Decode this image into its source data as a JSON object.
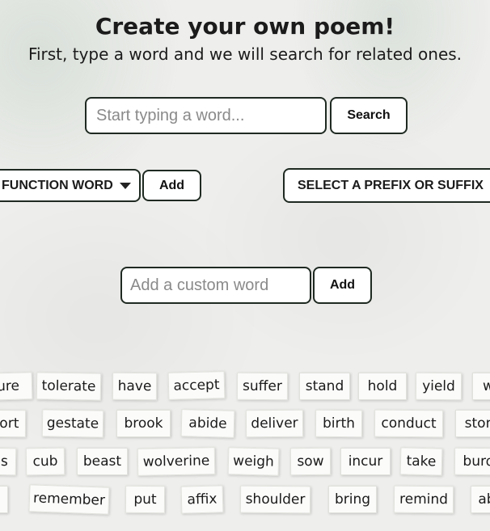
{
  "header": {
    "title": "Create your own poem!",
    "subtitle": "First, type a word and we will search for related ones."
  },
  "search": {
    "placeholder": "Start typing a word...",
    "button_label": "Search"
  },
  "controls": {
    "function_word_label": "FUNCTION WORD",
    "add_label": "Add",
    "prefix_suffix_label": "SELECT A PREFIX OR SUFFIX"
  },
  "custom": {
    "placeholder": "Add a custom word",
    "add_label": "Add"
  },
  "words": [
    [
      "ure",
      "tolerate",
      "have",
      "accept",
      "suffer",
      "stand",
      "hold",
      "yield",
      "w"
    ],
    [
      "port",
      "gestate",
      "brook",
      "abide",
      "deliver",
      "birth",
      "conduct",
      "ston"
    ],
    [
      "ps",
      "cub",
      "beast",
      "wolverine",
      "weigh",
      "sow",
      "incur",
      "take",
      "burd"
    ],
    [
      "y",
      "remember",
      "put",
      "affix",
      "shoulder",
      "bring",
      "remind",
      "ab"
    ]
  ]
}
